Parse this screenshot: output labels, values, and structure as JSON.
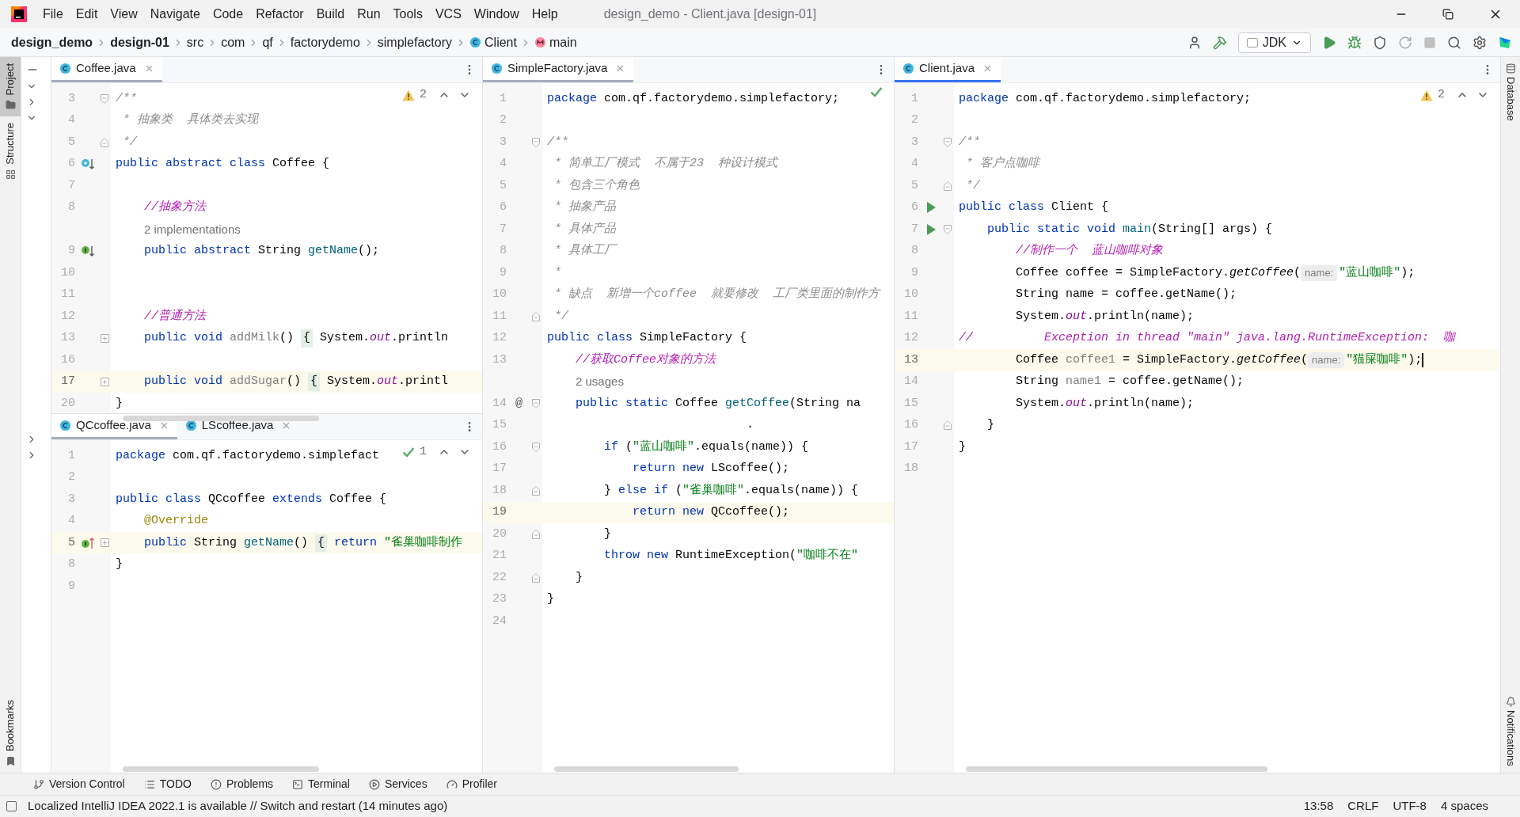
{
  "window": {
    "title": "design_demo - Client.java [design-01]"
  },
  "menu": [
    "File",
    "Edit",
    "View",
    "Navigate",
    "Code",
    "Refactor",
    "Build",
    "Run",
    "Tools",
    "VCS",
    "Window",
    "Help"
  ],
  "breadcrumbs": [
    {
      "text": "design_demo",
      "bold": true,
      "kind": "plain"
    },
    {
      "text": "design-01",
      "bold": true,
      "kind": "plain"
    },
    {
      "text": "src",
      "bold": false,
      "kind": "plain"
    },
    {
      "text": "com",
      "bold": false,
      "kind": "plain"
    },
    {
      "text": "qf",
      "bold": false,
      "kind": "plain"
    },
    {
      "text": "factorydemo",
      "bold": false,
      "kind": "plain"
    },
    {
      "text": "simplefactory",
      "bold": false,
      "kind": "plain"
    },
    {
      "text": "Client",
      "bold": false,
      "kind": "class"
    },
    {
      "text": "main",
      "bold": false,
      "kind": "method"
    }
  ],
  "run_config": "JDK",
  "left_strip": [
    {
      "label": "Project",
      "selected": true
    },
    {
      "label": "Structure",
      "selected": false
    }
  ],
  "left_strip_bottom": [
    "Bookmarks"
  ],
  "right_strip": [
    "Database"
  ],
  "right_strip_bottom": [
    "Notifications"
  ],
  "columns": [
    [
      {
        "focused": false,
        "tabs": [
          {
            "label": "Coffee.java",
            "selected": true
          }
        ],
        "inspection": {
          "kind": "warning",
          "count": "2"
        },
        "lines": [
          {
            "kind": "code",
            "n": "3",
            "fold": {
              "kind": "start"
            },
            "tokens": [
              {
                "kind": "doc",
                "text": "/**"
              }
            ]
          },
          {
            "kind": "code",
            "n": "4",
            "tokens": [
              {
                "kind": "doc",
                "text": " * 抽象类  具体类去实现"
              }
            ]
          },
          {
            "kind": "code",
            "n": "5",
            "fold": {
              "kind": "end"
            },
            "tokens": [
              {
                "kind": "doc",
                "text": " */"
              }
            ]
          },
          {
            "kind": "code",
            "n": "6",
            "gutter": {
              "kind": "overridden"
            },
            "tokens": [
              {
                "kind": "kw",
                "text": "public abstract class "
              },
              {
                "kind": "plain",
                "text": "Coffee {"
              }
            ]
          },
          {
            "kind": "code",
            "n": "7"
          },
          {
            "kind": "code",
            "n": "8",
            "tokens": [
              {
                "kind": "comment",
                "text": "    //抽象方法"
              }
            ]
          },
          {
            "kind": "hint",
            "text": "2 implementations"
          },
          {
            "kind": "code",
            "n": "9",
            "gutter": {
              "kind": "implemented"
            },
            "tokens": [
              {
                "kind": "kw",
                "text": "    public abstract "
              },
              {
                "kind": "plain",
                "text": "String "
              },
              {
                "kind": "method",
                "text": "getName"
              },
              {
                "kind": "plain",
                "text": "();"
              }
            ]
          },
          {
            "kind": "code",
            "n": "10"
          },
          {
            "kind": "code",
            "n": "11"
          },
          {
            "kind": "code",
            "n": "12",
            "tokens": [
              {
                "kind": "comment",
                "text": "    //普通方法"
              }
            ]
          },
          {
            "kind": "code",
            "n": "13",
            "fold": {
              "kind": "plus"
            },
            "tokens": [
              {
                "kind": "kw",
                "text": "    public void "
              },
              {
                "kind": "unused",
                "text": "addMilk"
              },
              {
                "kind": "plain",
                "text": "() "
              },
              {
                "kind": "folded",
                "text": "{"
              },
              {
                "kind": "plain",
                "text": " System."
              },
              {
                "kind": "static",
                "text": "out"
              },
              {
                "kind": "plain",
                "text": ".println"
              }
            ]
          },
          {
            "kind": "code",
            "n": "16"
          },
          {
            "kind": "code",
            "n": "17",
            "current": true,
            "fold": {
              "kind": "plus"
            },
            "tokens": [
              {
                "kind": "kw",
                "text": "    public void "
              },
              {
                "kind": "unused",
                "text": "addSugar"
              },
              {
                "kind": "plain",
                "text": "() "
              },
              {
                "kind": "folded",
                "text": "{"
              },
              {
                "kind": "plain",
                "text": " System."
              },
              {
                "kind": "static",
                "text": "out"
              },
              {
                "kind": "plain",
                "text": ".printl"
              }
            ]
          },
          {
            "kind": "code",
            "n": "20",
            "tokens": [
              {
                "kind": "plain",
                "text": "}"
              }
            ]
          }
        ]
      },
      {
        "focused": false,
        "tabs": [
          {
            "label": "QCcoffee.java",
            "selected": true
          },
          {
            "label": "LScoffee.java",
            "selected": false
          }
        ],
        "inspection": {
          "kind": "ok",
          "count": "1"
        },
        "lines": [
          {
            "kind": "code",
            "n": "1",
            "tokens": [
              {
                "kind": "kw",
                "text": "package "
              },
              {
                "kind": "plain",
                "text": "com.qf.factorydemo.simplefact"
              }
            ]
          },
          {
            "kind": "code",
            "n": "2"
          },
          {
            "kind": "code",
            "n": "3",
            "tokens": [
              {
                "kind": "kw",
                "text": "public class "
              },
              {
                "kind": "plain",
                "text": "QCcoffee "
              },
              {
                "kind": "kw",
                "text": "extends "
              },
              {
                "kind": "plain",
                "text": "Coffee {"
              }
            ]
          },
          {
            "kind": "code",
            "n": "4",
            "tokens": [
              {
                "kind": "annotation",
                "text": "    @Override"
              }
            ]
          },
          {
            "kind": "code",
            "n": "5",
            "current": true,
            "gutter": {
              "kind": "implements"
            },
            "fold": {
              "kind": "plus"
            },
            "tokens": [
              {
                "kind": "kw",
                "text": "    public "
              },
              {
                "kind": "plain",
                "text": "String "
              },
              {
                "kind": "method",
                "text": "getName"
              },
              {
                "kind": "plain",
                "text": "() "
              },
              {
                "kind": "folded",
                "text": "{"
              },
              {
                "kind": "kw",
                "text": " return "
              },
              {
                "kind": "str",
                "text": "\"雀巢咖啡制作"
              }
            ]
          },
          {
            "kind": "code",
            "n": "8",
            "tokens": [
              {
                "kind": "plain",
                "text": "}"
              }
            ]
          },
          {
            "kind": "code",
            "n": "9"
          }
        ]
      }
    ],
    [
      {
        "focused": false,
        "tabs": [
          {
            "label": "SimpleFactory.java",
            "selected": true
          }
        ],
        "inspection": {
          "kind": "ok"
        },
        "lines": [
          {
            "kind": "code",
            "n": "1",
            "tokens": [
              {
                "kind": "kw",
                "text": "package "
              },
              {
                "kind": "plain",
                "text": "com.qf.factorydemo.simplefactory;"
              }
            ]
          },
          {
            "kind": "code",
            "n": "2"
          },
          {
            "kind": "code",
            "n": "3",
            "fold": {
              "kind": "start"
            },
            "tokens": [
              {
                "kind": "doc",
                "text": "/**"
              }
            ]
          },
          {
            "kind": "code",
            "n": "4",
            "tokens": [
              {
                "kind": "doc",
                "text": " * 简单工厂模式  不属于23  种设计模式"
              }
            ]
          },
          {
            "kind": "code",
            "n": "5",
            "tokens": [
              {
                "kind": "doc",
                "text": " * 包含三个角色"
              }
            ]
          },
          {
            "kind": "code",
            "n": "6",
            "tokens": [
              {
                "kind": "doc",
                "text": " * 抽象产品"
              }
            ]
          },
          {
            "kind": "code",
            "n": "7",
            "tokens": [
              {
                "kind": "doc",
                "text": " * 具体产品"
              }
            ]
          },
          {
            "kind": "code",
            "n": "8",
            "tokens": [
              {
                "kind": "doc",
                "text": " * 具体工厂"
              }
            ]
          },
          {
            "kind": "code",
            "n": "9",
            "tokens": [
              {
                "kind": "doc",
                "text": " *"
              }
            ]
          },
          {
            "kind": "code",
            "n": "10",
            "tokens": [
              {
                "kind": "doc",
                "text": " * 缺点  新增一个coffee  就要修改  工厂类里面的制作方"
              }
            ]
          },
          {
            "kind": "code",
            "n": "11",
            "fold": {
              "kind": "end"
            },
            "tokens": [
              {
                "kind": "doc",
                "text": " */"
              }
            ]
          },
          {
            "kind": "code",
            "n": "12",
            "tokens": [
              {
                "kind": "kw",
                "text": "public class "
              },
              {
                "kind": "plain",
                "text": "SimpleFactory {"
              }
            ]
          },
          {
            "kind": "code",
            "n": "13",
            "tokens": [
              {
                "kind": "comment",
                "text": "    //获取Coffee对象的方法"
              }
            ]
          },
          {
            "kind": "hint",
            "text": "2 usages"
          },
          {
            "kind": "code",
            "n": "14",
            "gutter_text": "@",
            "fold": {
              "kind": "start"
            },
            "tokens": [
              {
                "kind": "kw",
                "text": "    public static "
              },
              {
                "kind": "plain",
                "text": "Coffee "
              },
              {
                "kind": "method",
                "text": "getCoffee"
              },
              {
                "kind": "plain",
                "text": "(String na"
              }
            ]
          },
          {
            "kind": "code",
            "n": "15",
            "tokens": [
              {
                "kind": "plain",
                "text": "                            ."
              }
            ]
          },
          {
            "kind": "code",
            "n": "16",
            "fold": {
              "kind": "start"
            },
            "tokens": [
              {
                "kind": "kw",
                "text": "        if "
              },
              {
                "kind": "plain",
                "text": "("
              },
              {
                "kind": "str",
                "text": "\"蓝山咖啡\""
              },
              {
                "kind": "plain",
                "text": ".equals(name)) {"
              }
            ]
          },
          {
            "kind": "code",
            "n": "17",
            "tokens": [
              {
                "kind": "kw",
                "text": "            return new "
              },
              {
                "kind": "plain",
                "text": "LScoffee();"
              }
            ]
          },
          {
            "kind": "code",
            "n": "18",
            "fold": {
              "kind": "end"
            },
            "tokens": [
              {
                "kind": "plain",
                "text": "        } "
              },
              {
                "kind": "kw",
                "text": "else if "
              },
              {
                "kind": "plain",
                "text": "("
              },
              {
                "kind": "str",
                "text": "\"雀巢咖啡\""
              },
              {
                "kind": "plain",
                "text": ".equals(name)) {"
              }
            ]
          },
          {
            "kind": "code",
            "n": "19",
            "current": true,
            "tokens": [
              {
                "kind": "kw",
                "text": "            return new "
              },
              {
                "kind": "plain",
                "text": "QCcoffee();"
              }
            ]
          },
          {
            "kind": "code",
            "n": "20",
            "fold": {
              "kind": "end"
            },
            "tokens": [
              {
                "kind": "plain",
                "text": "        }"
              }
            ]
          },
          {
            "kind": "code",
            "n": "21",
            "tokens": [
              {
                "kind": "kw",
                "text": "        throw new "
              },
              {
                "kind": "plain",
                "text": "RuntimeException("
              },
              {
                "kind": "str",
                "text": "\"咖啡不在\""
              }
            ]
          },
          {
            "kind": "code",
            "n": "22",
            "fold": {
              "kind": "end"
            },
            "tokens": [
              {
                "kind": "plain",
                "text": "    }"
              }
            ]
          },
          {
            "kind": "code",
            "n": "23",
            "tokens": [
              {
                "kind": "plain",
                "text": "}"
              }
            ]
          },
          {
            "kind": "code",
            "n": "24"
          }
        ]
      }
    ],
    [
      {
        "focused": true,
        "tabs": [
          {
            "label": "Client.java",
            "selected": true
          }
        ],
        "inspection": {
          "kind": "warning",
          "count": "2"
        },
        "lines": [
          {
            "kind": "code",
            "n": "1",
            "tokens": [
              {
                "kind": "kw",
                "text": "package "
              },
              {
                "kind": "plain",
                "text": "com.qf.factorydemo.simplefactory;"
              }
            ]
          },
          {
            "kind": "code",
            "n": "2"
          },
          {
            "kind": "code",
            "n": "3",
            "fold": {
              "kind": "start"
            },
            "tokens": [
              {
                "kind": "doc",
                "text": "/**"
              }
            ]
          },
          {
            "kind": "code",
            "n": "4",
            "tokens": [
              {
                "kind": "doc",
                "text": " * 客户点咖啡"
              }
            ]
          },
          {
            "kind": "code",
            "n": "5",
            "fold": {
              "kind": "end"
            },
            "tokens": [
              {
                "kind": "doc",
                "text": " */"
              }
            ]
          },
          {
            "kind": "code",
            "n": "6",
            "gutter": {
              "kind": "run"
            },
            "tokens": [
              {
                "kind": "kw",
                "text": "public class "
              },
              {
                "kind": "plain",
                "text": "Client {"
              }
            ]
          },
          {
            "kind": "code",
            "n": "7",
            "gutter": {
              "kind": "run"
            },
            "fold": {
              "kind": "start"
            },
            "tokens": [
              {
                "kind": "kw",
                "text": "    public static void "
              },
              {
                "kind": "method",
                "text": "main"
              },
              {
                "kind": "plain",
                "text": "(String[] args) {"
              }
            ]
          },
          {
            "kind": "code",
            "n": "8",
            "tokens": [
              {
                "kind": "comment",
                "text": "        //制作一个  蓝山咖啡对象"
              }
            ]
          },
          {
            "kind": "code",
            "n": "9",
            "tokens": [
              {
                "kind": "plain",
                "text": "        Coffee coffee = SimpleFactory."
              },
              {
                "kind": "italic",
                "text": "getCoffee"
              },
              {
                "kind": "plain",
                "text": "("
              },
              {
                "kind": "inlay",
                "text": "name:"
              },
              {
                "kind": "str",
                "text": "\"蓝山咖啡\""
              },
              {
                "kind": "plain",
                "text": ");"
              }
            ]
          },
          {
            "kind": "code",
            "n": "10",
            "tokens": [
              {
                "kind": "plain",
                "text": "        String name = coffee.getName();"
              }
            ]
          },
          {
            "kind": "code",
            "n": "11",
            "tokens": [
              {
                "kind": "plain",
                "text": "        System."
              },
              {
                "kind": "static",
                "text": "out"
              },
              {
                "kind": "plain",
                "text": ".println(name);"
              }
            ]
          },
          {
            "kind": "code",
            "n": "12",
            "tokens": [
              {
                "kind": "comment",
                "text": "//          Exception in thread \"main\" java.lang.RuntimeException:  咖"
              }
            ]
          },
          {
            "kind": "code",
            "n": "13",
            "current": true,
            "caret": true,
            "tokens": [
              {
                "kind": "plain",
                "text": "        Coffee "
              },
              {
                "kind": "unused",
                "text": "coffee1"
              },
              {
                "kind": "plain",
                "text": " = SimpleFactory."
              },
              {
                "kind": "italic",
                "text": "getCoffee"
              },
              {
                "kind": "plain",
                "text": "("
              },
              {
                "kind": "inlay",
                "text": "name:"
              },
              {
                "kind": "str",
                "text": "\"猫屎咖啡\""
              },
              {
                "kind": "plain",
                "text": ");"
              }
            ]
          },
          {
            "kind": "code",
            "n": "14",
            "tokens": [
              {
                "kind": "plain",
                "text": "        String "
              },
              {
                "kind": "unused",
                "text": "name1"
              },
              {
                "kind": "plain",
                "text": " = coffee.getName();"
              }
            ]
          },
          {
            "kind": "code",
            "n": "15",
            "tokens": [
              {
                "kind": "plain",
                "text": "        System."
              },
              {
                "kind": "static",
                "text": "out"
              },
              {
                "kind": "plain",
                "text": ".println(name);"
              }
            ]
          },
          {
            "kind": "code",
            "n": "16",
            "fold": {
              "kind": "end"
            },
            "tokens": [
              {
                "kind": "plain",
                "text": "    }"
              }
            ]
          },
          {
            "kind": "code",
            "n": "17",
            "tokens": [
              {
                "kind": "plain",
                "text": "}"
              }
            ]
          },
          {
            "kind": "code",
            "n": "18"
          }
        ]
      }
    ]
  ],
  "bottom_tools": [
    "Version Control",
    "TODO",
    "Problems",
    "Terminal",
    "Services",
    "Profiler"
  ],
  "status": {
    "message": "Localized IntelliJ IDEA 2022.1 is available // Switch and restart (14 minutes ago)",
    "items": [
      "13:58",
      "CRLF",
      "UTF-8",
      "4 spaces"
    ]
  }
}
